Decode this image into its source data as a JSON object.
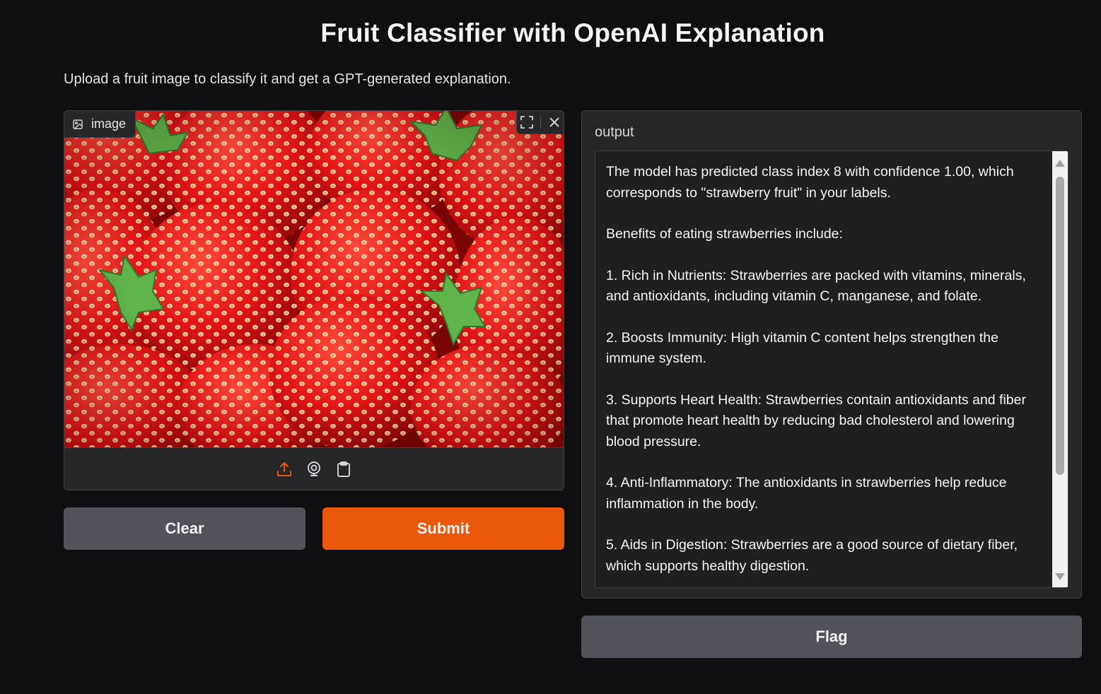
{
  "app": {
    "title": "Fruit Classifier with OpenAI Explanation",
    "description": "Upload a fruit image to classify it and get a GPT-generated explanation."
  },
  "input": {
    "label": "image",
    "label_icon": "image-icon",
    "tools": [
      "fullscreen-icon",
      "close-icon"
    ],
    "sources": [
      "upload-icon",
      "webcam-icon",
      "clipboard-icon"
    ],
    "accent_color": "#ea580c"
  },
  "buttons": {
    "clear": "Clear",
    "submit": "Submit",
    "flag": "Flag"
  },
  "output": {
    "label": "output",
    "paragraphs": [
      "The model has predicted class index 8 with confidence 1.00, which corresponds to \"strawberry fruit\" in your labels.",
      "Benefits of eating strawberries include:",
      "1. Rich in Nutrients: Strawberries are packed with vitamins, minerals, and antioxidants, including vitamin C, manganese, and folate.",
      "2. Boosts Immunity: High vitamin C content helps strengthen the immune system.",
      "3. Supports Heart Health: Strawberries contain antioxidants and fiber that promote heart health by reducing bad cholesterol and lowering blood pressure.",
      "4. Anti-Inflammatory: The antioxidants in strawberries help reduce inflammation in the body.",
      "5. Aids in Digestion: Strawberries are a good source of dietary fiber, which supports healthy digestion."
    ]
  }
}
